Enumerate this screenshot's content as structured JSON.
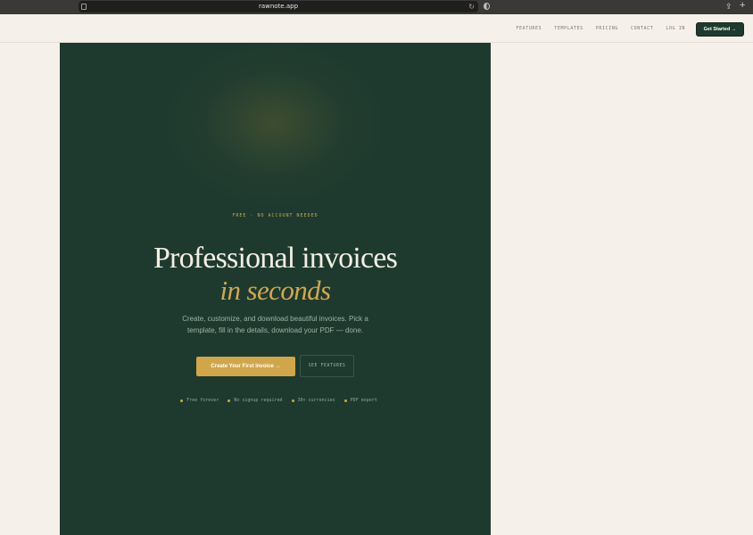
{
  "browser": {
    "url": "rawnote.app"
  },
  "nav": {
    "links": [
      "FEATURES",
      "TEMPLATES",
      "PRICING",
      "CONTACT",
      "LOG IN"
    ],
    "cta": "Get Started →"
  },
  "hero": {
    "eyebrow": "FREE · NO ACCOUNT NEEDED",
    "headline": "Professional invoices",
    "headline_accent": "in seconds",
    "subtext": "Create, customize, and download beautiful invoices. Pick a template, fill in the details, download your PDF — done.",
    "primary_button": "Create Your First Invoice →",
    "secondary_button": "SEE FEATURES",
    "features": [
      "Free forever",
      "No signup required",
      "30+ currencies",
      "PDF export"
    ]
  },
  "colors": {
    "brand_green": "#1e3a2f",
    "accent_gold": "#d1a64a",
    "page_bg": "#f5f1ea"
  }
}
